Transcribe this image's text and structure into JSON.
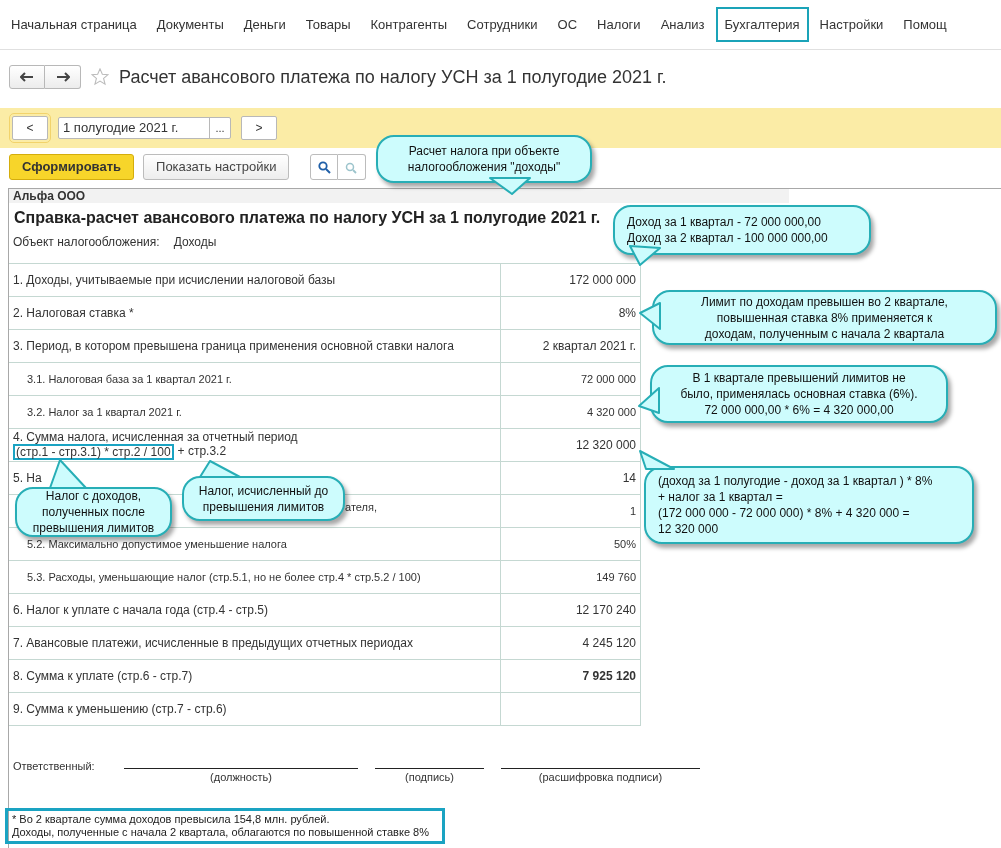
{
  "menu": [
    {
      "label": "Начальная страница",
      "selected": false
    },
    {
      "label": "Документы",
      "selected": false
    },
    {
      "label": "Деньги",
      "selected": false
    },
    {
      "label": "Товары",
      "selected": false
    },
    {
      "label": "Контрагенты",
      "selected": false
    },
    {
      "label": "Сотрудники",
      "selected": false
    },
    {
      "label": "ОС",
      "selected": false
    },
    {
      "label": "Налоги",
      "selected": false
    },
    {
      "label": "Анализ",
      "selected": false
    },
    {
      "label": "Бухгалтерия",
      "selected": true
    },
    {
      "label": "Настройки",
      "selected": false
    },
    {
      "label": "Помощ",
      "selected": false
    }
  ],
  "title": "Расчет авансового платежа по налогу УСН за 1 полугодие 2021 г.",
  "period": {
    "prev": "<",
    "value": "1 полугодие 2021 г.",
    "choose": "...",
    "next": ">"
  },
  "buttons": [
    {
      "label": "Сформировать",
      "kind": "primary"
    },
    {
      "label": "Показать настройки",
      "kind": "default"
    }
  ],
  "report": {
    "organization": "Альфа ООО",
    "heading": "Справка-расчет авансового платежа по налогу УСН за 1 полугодие 2021 г.",
    "object_label": "Объект налогообложения:",
    "object_value": "Доходы",
    "rows": [
      {
        "kind": "main",
        "label": "1. Доходы, учитываемые при исчислении налоговой базы",
        "value": "172 000 000",
        "bold": false
      },
      {
        "kind": "main",
        "label": "2. Налоговая ставка *",
        "value": "8%",
        "bold": false
      },
      {
        "kind": "main",
        "label": "3. Период, в котором превышена граница применения основной ставки налога",
        "value": "2 квартал 2021 г.",
        "bold": false
      },
      {
        "kind": "sub",
        "label": "3.1. Налоговая база за 1 квартал 2021 г.",
        "value": "72 000 000",
        "bold": false
      },
      {
        "kind": "sub",
        "label": "3.2. Налог за 1 квартал 2021 г.",
        "value": "4 320 000",
        "bold": false
      },
      {
        "kind": "formula",
        "label": "4. Сумма налога, исчисленная за отчетный период",
        "formula_highlight": "(стр.1 - стр.3.1) * стр.2 / 100",
        "formula_rest": "+ стр.3.2",
        "value": "12 320 000",
        "bold": false
      },
      {
        "kind": "main",
        "label": "5. На",
        "value": "14",
        "bold": false
      },
      {
        "kind": "covered",
        "label": "ателя,",
        "value": "1",
        "bold": false
      },
      {
        "kind": "sub",
        "label": "5.2. Максимально допустимое уменьшение налога",
        "value": "50%",
        "bold": false
      },
      {
        "kind": "sub",
        "label": "5.3. Расходы, уменьшающие налог (стр.5.1, но не более стр.4 * стр.5.2 / 100)",
        "value": "149 760",
        "bold": false
      },
      {
        "kind": "main",
        "label": "6. Налог к уплате с начала года (стр.4 - стр.5)",
        "value": "12 170 240",
        "bold": false
      },
      {
        "kind": "main",
        "label": "7. Авансовые платежи, исчисленные в предыдущих отчетных периодах",
        "value": "4 245 120",
        "bold": false
      },
      {
        "kind": "main",
        "label": "8. Сумма к уплате (стр.6 - стр.7)",
        "value": "7 925 120",
        "bold": true
      },
      {
        "kind": "main",
        "label": "9. Сумма к уменьшению (стр.7 - стр.6)"
      }
    ],
    "signature": {
      "label": "Ответственный:",
      "captions": [
        "(должность)",
        "(подпись)",
        "(расшифровка подписи)"
      ]
    },
    "footnote": [
      "* Во 2 квартале сумма доходов превысила 154,8 млн. рублей.",
      "Доходы, полученные с начала 2 квартала, облагаются по повышенной ставке 8%"
    ]
  },
  "callouts": [
    {
      "lines": [
        "Расчет налога при объекте",
        "налогообложения \"доходы\""
      ]
    },
    {
      "lines": [
        "Доход за 1 квартал - 72 000 000,00",
        "Доход за 2 квартал - 100 000 000,00"
      ]
    },
    {
      "lines": [
        "Лимит по доходам превышен во 2 квартале,",
        "повышенная ставка 8% применяется к",
        "доходам, полученным с начала 2 квартала"
      ]
    },
    {
      "lines": [
        "В 1 квартале превышений лимитов не",
        "было, применялась основная ставка (6%).",
        "72 000 000,00 * 6% = 4 320 000,00"
      ]
    },
    {
      "lines": [
        "Налог с доходов,",
        "полученных после",
        "превышения лимитов"
      ]
    },
    {
      "lines": [
        "Налог, исчисленный до",
        "превышения лимитов"
      ]
    },
    {
      "lines": [
        "(доход за 1 полугодие - доход за 1 квартал ) * 8%",
        "+ налог за 1 квартал =",
        "(172 000 000 - 72 000 000) * 8% + 4 320 000 =",
        "12 320 000"
      ]
    }
  ]
}
